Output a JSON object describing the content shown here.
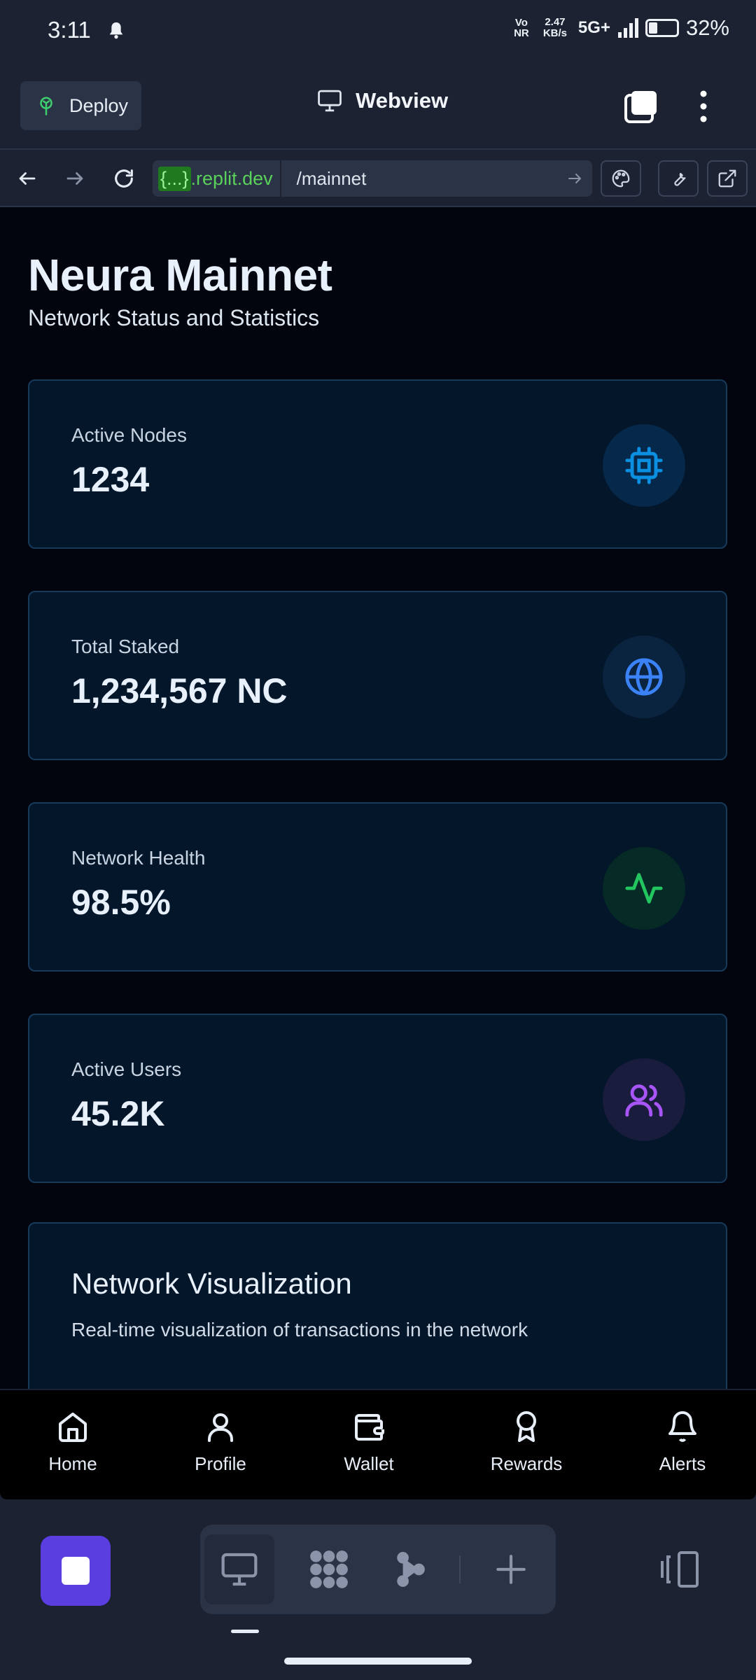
{
  "status": {
    "time": "3:11",
    "volte": "Vo NR",
    "speed_value": "2.47",
    "speed_unit": "KB/s",
    "network": "5G+",
    "battery": "32%",
    "battery_level": 0.32
  },
  "header": {
    "deploy_label": "Deploy",
    "title": "Webview"
  },
  "urlbar": {
    "domain_prefix": "{...}",
    "domain_suffix": ".replit.dev",
    "path": "/mainnet"
  },
  "page": {
    "title": "Neura Mainnet",
    "subtitle": "Network Status and Statistics"
  },
  "stats": [
    {
      "label": "Active Nodes",
      "value": "1234",
      "icon": "cpu-icon",
      "color": "#0b8fe0"
    },
    {
      "label": "Total Staked",
      "value": "1,234,567 NC",
      "icon": "globe-icon",
      "color": "#3a82f6"
    },
    {
      "label": "Network Health",
      "value": "98.5%",
      "icon": "activity-icon",
      "color": "#22c55e"
    },
    {
      "label": "Active Users",
      "value": "45.2K",
      "icon": "users-icon",
      "color": "#a855f7"
    }
  ],
  "visualization": {
    "title": "Network Visualization",
    "description": "Real-time visualization of transactions in the network"
  },
  "bottom_nav": [
    {
      "label": "Home",
      "icon": "home-icon"
    },
    {
      "label": "Profile",
      "icon": "user-icon"
    },
    {
      "label": "Wallet",
      "icon": "wallet-icon"
    },
    {
      "label": "Rewards",
      "icon": "award-icon"
    },
    {
      "label": "Alerts",
      "icon": "bell-icon"
    }
  ],
  "colors": {
    "accent": "#5b3ee0",
    "background": "#02050d",
    "card": "#03162a"
  }
}
